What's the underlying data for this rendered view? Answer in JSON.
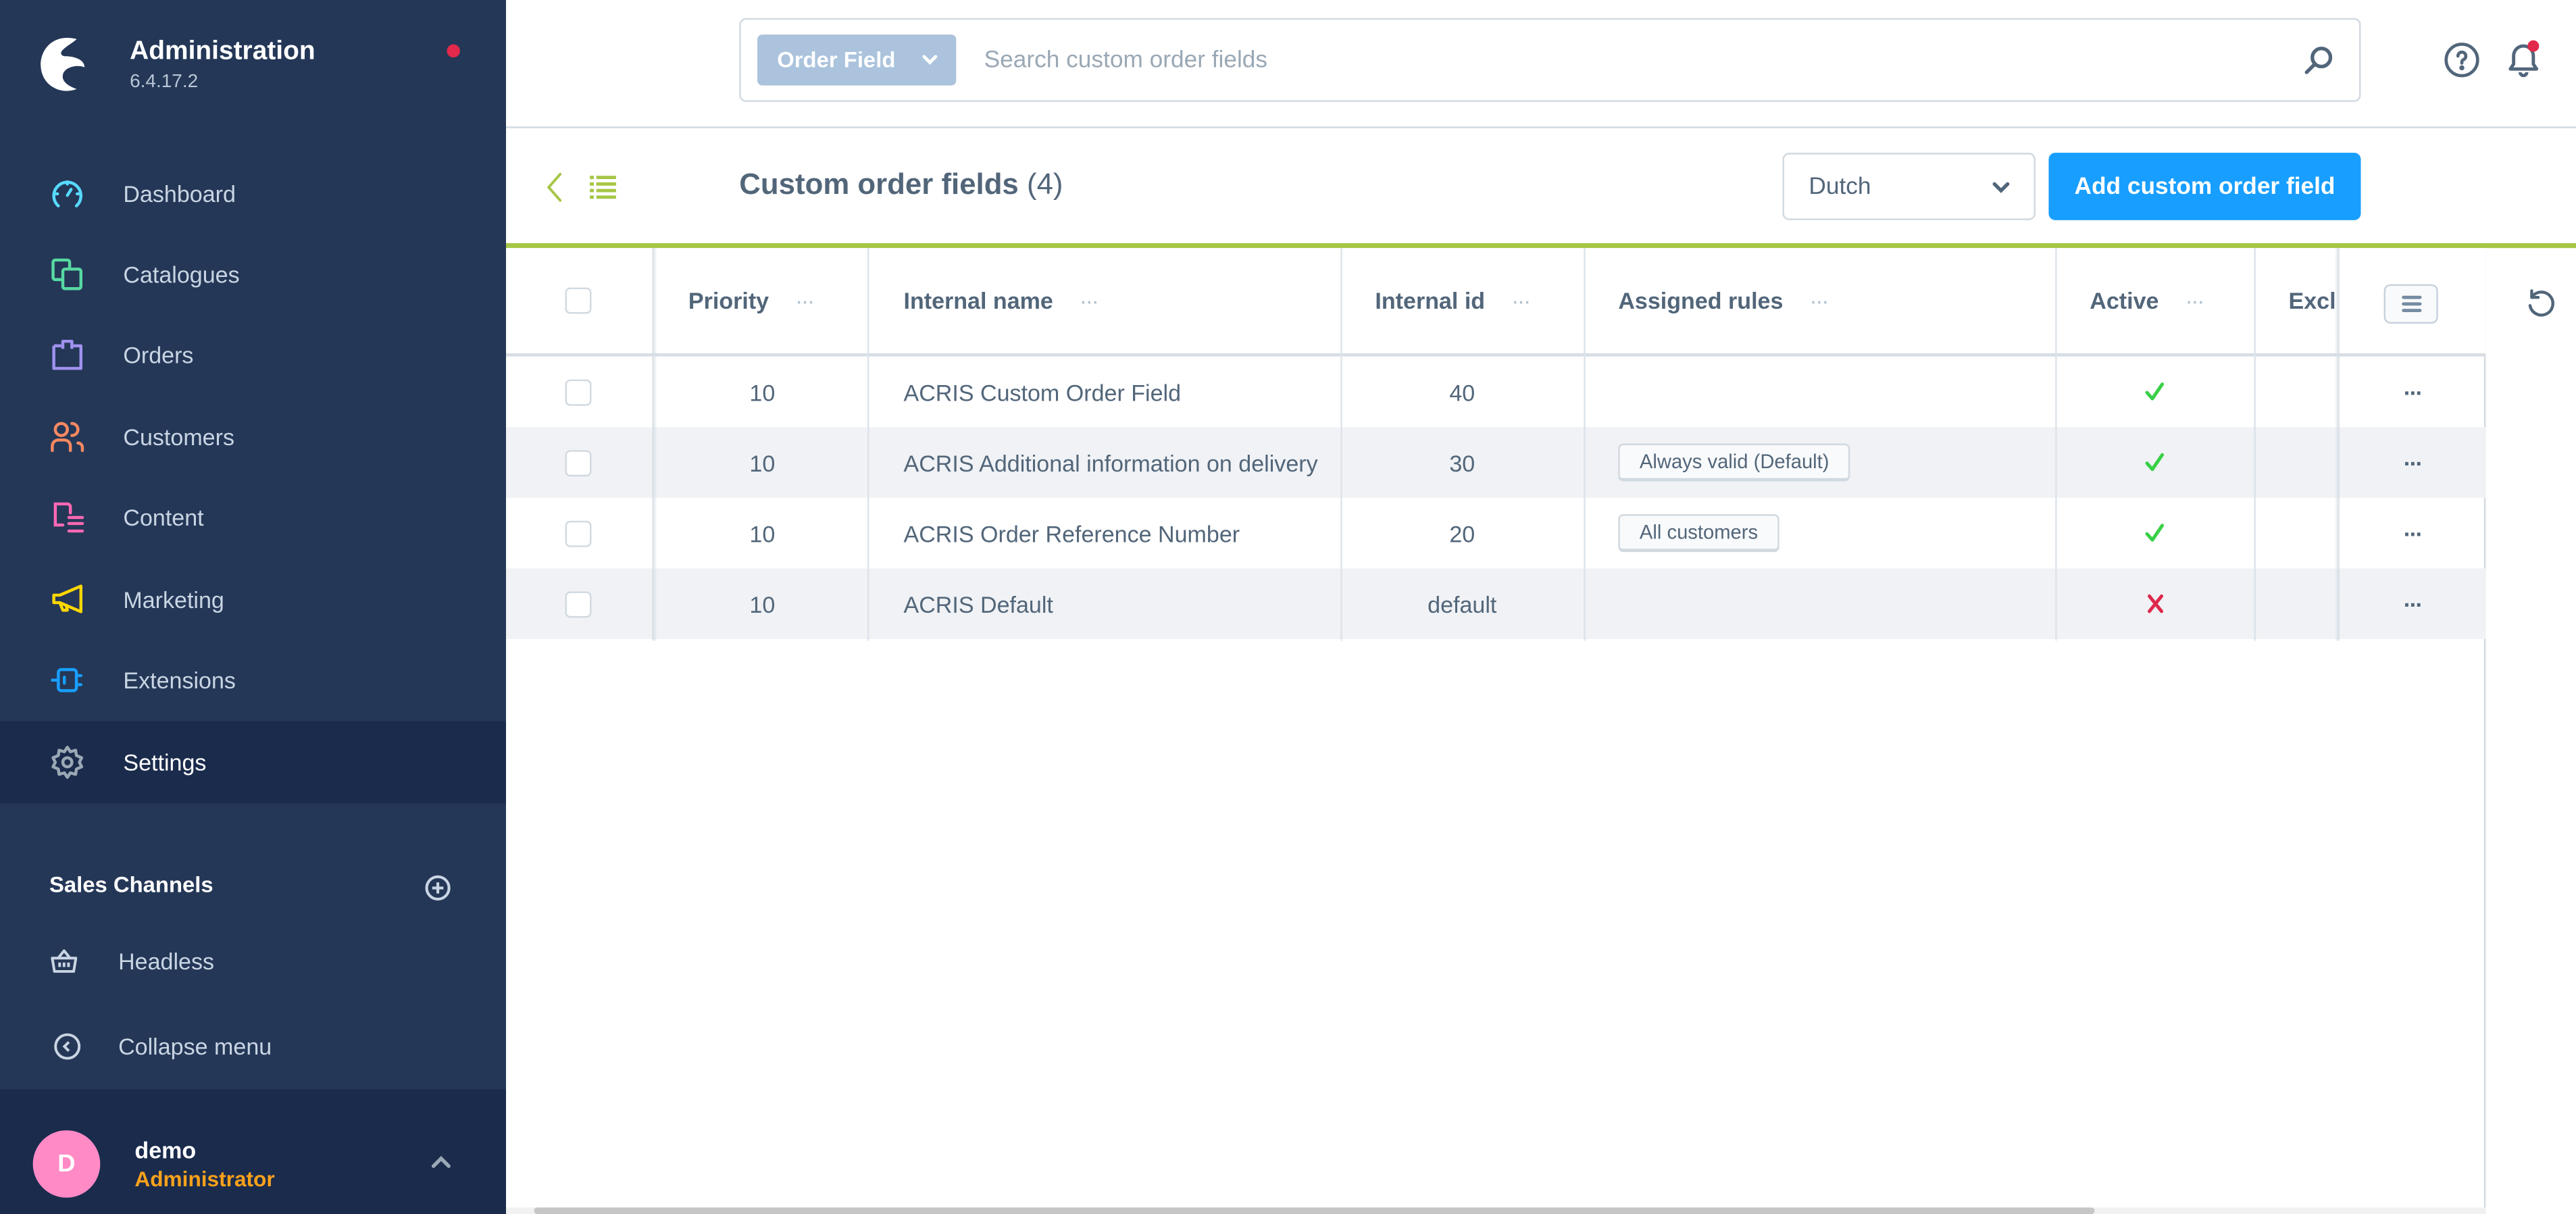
{
  "app": {
    "title": "Administration",
    "version": "6.4.17.2"
  },
  "sidebar": {
    "items": [
      {
        "label": "Dashboard",
        "icon": "dashboard-icon",
        "color": "#57d9ff"
      },
      {
        "label": "Catalogues",
        "icon": "catalogues-icon",
        "color": "#57d9a3"
      },
      {
        "label": "Orders",
        "icon": "orders-icon",
        "color": "#a092f0"
      },
      {
        "label": "Customers",
        "icon": "customers-icon",
        "color": "#f88962"
      },
      {
        "label": "Content",
        "icon": "content-icon",
        "color": "#ff68b4"
      },
      {
        "label": "Marketing",
        "icon": "marketing-icon",
        "color": "#ffd700"
      },
      {
        "label": "Extensions",
        "icon": "extensions-icon",
        "color": "#189eff"
      },
      {
        "label": "Settings",
        "icon": "settings-icon",
        "color": "#9aa8b5",
        "active": true
      }
    ],
    "sales_channels_title": "Sales Channels",
    "sales_channels": [
      {
        "label": "Headless",
        "icon": "basket-icon"
      }
    ],
    "collapse_label": "Collapse menu",
    "user": {
      "initial": "D",
      "name": "demo",
      "role": "Administrator"
    }
  },
  "topbar": {
    "search_type": "Order Field",
    "search_placeholder": "Search custom order fields",
    "search_value": ""
  },
  "smartbar": {
    "title": "Custom order fields",
    "count": "(4)",
    "language": "Dutch",
    "add_button": "Add custom order field"
  },
  "grid": {
    "columns": [
      "Priority",
      "Internal name",
      "Internal id",
      "Assigned rules",
      "Active",
      "Exclu"
    ],
    "column_menu": "···",
    "rows": [
      {
        "priority": "10",
        "name": "ACRIS Custom Order Field",
        "id": "40",
        "rules": "",
        "active": true
      },
      {
        "priority": "10",
        "name": "ACRIS Additional information on delivery",
        "id": "30",
        "rules": "Always valid (Default)",
        "active": true
      },
      {
        "priority": "10",
        "name": "ACRIS Order Reference Number",
        "id": "20",
        "rules": "All customers",
        "active": true
      },
      {
        "priority": "10",
        "name": "ACRIS Default",
        "id": "default",
        "rules": "",
        "active": false
      }
    ],
    "row_actions": "···"
  },
  "colors": {
    "sidebar_bg": "#243757",
    "sidebar_active": "#1a2b4c",
    "primary": "#189eff",
    "accent_green": "#a6c646",
    "check_green": "#37d046",
    "cross_red": "#de294c",
    "notification_red": "#e2294b",
    "role_orange": "#f9a11b",
    "avatar_pink": "#ff8ac6"
  }
}
